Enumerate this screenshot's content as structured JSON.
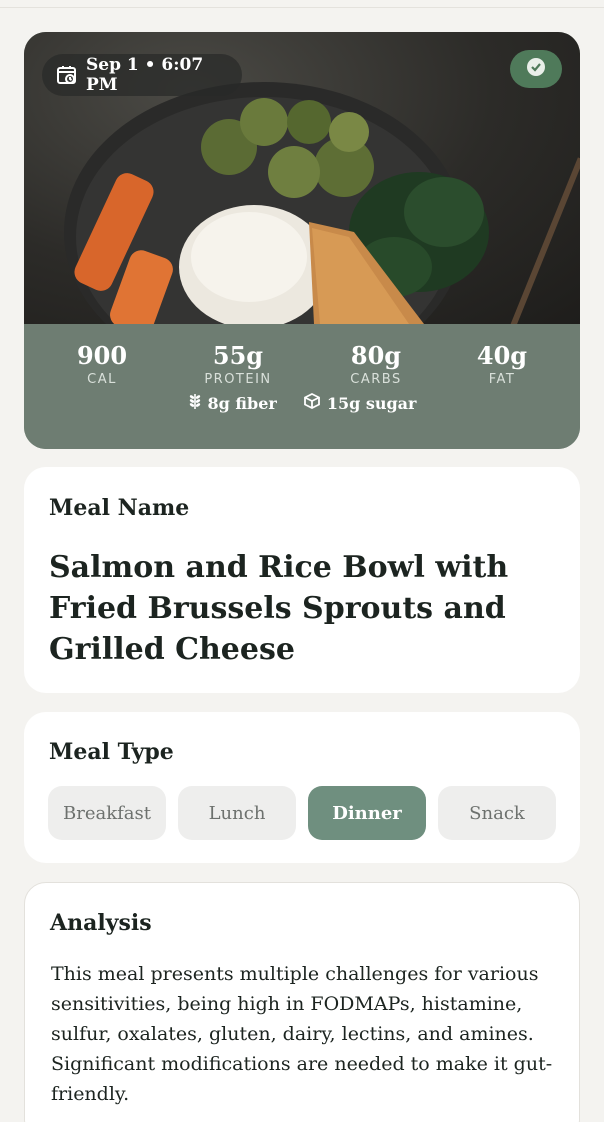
{
  "hero": {
    "date_time": "Sep 1 • 6:07 PM",
    "calendar_icon": "calendar-clock-icon",
    "logged_icon": "check-circle-icon",
    "macros": [
      {
        "value": "900",
        "label": "CAL"
      },
      {
        "value": "55g",
        "label": "PROTEIN"
      },
      {
        "value": "80g",
        "label": "CARBS"
      },
      {
        "value": "40g",
        "label": "FAT"
      }
    ],
    "fiber": "8g fiber",
    "fiber_icon": "wheat-icon",
    "sugar": "15g sugar",
    "sugar_icon": "cube-icon"
  },
  "meal_name": {
    "label": "Meal Name",
    "value": "Salmon and Rice Bowl with Fried Brussels Sprouts and Grilled Cheese"
  },
  "meal_type": {
    "label": "Meal Type",
    "options": [
      "Breakfast",
      "Lunch",
      "Dinner",
      "Snack"
    ],
    "selected": "Dinner"
  },
  "analysis": {
    "label": "Analysis",
    "text": "This meal presents multiple challenges for various sensitivities, being high in FODMAPs, histamine, sulfur, oxalates, gluten, dairy, lectins, and amines. Significant modifications are needed to make it gut-friendly."
  },
  "colors": {
    "background": "#f4f3f0",
    "macro_panel": "#6e7d72",
    "accent": "#6f8f7f",
    "badge": "#4f7a5a"
  }
}
